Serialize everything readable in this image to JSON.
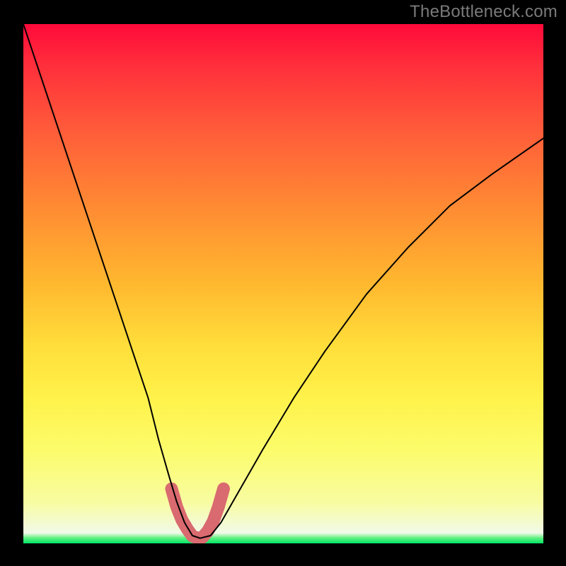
{
  "watermark": "TheBottleneck.com",
  "chart_data": {
    "type": "line",
    "title": "",
    "xlabel": "",
    "ylabel": "",
    "xlim": [
      0,
      100
    ],
    "ylim": [
      0,
      100
    ],
    "grid": false,
    "series": [
      {
        "name": "bottleneck-curve",
        "x": [
          0,
          3,
          6,
          9,
          12,
          15,
          18,
          21,
          24,
          26,
          28,
          29.5,
          31,
          32.5,
          34,
          36,
          38,
          42,
          46,
          52,
          58,
          66,
          74,
          82,
          90,
          100
        ],
        "y": [
          100,
          91,
          82,
          73,
          64,
          55,
          46,
          37,
          28,
          20,
          13,
          8,
          4,
          1.5,
          1,
          1.5,
          4,
          11,
          18,
          28,
          37,
          48,
          57,
          65,
          71,
          78
        ],
        "color": "#000000",
        "stroke_width": 2
      },
      {
        "name": "highlight-u",
        "x": [
          28.5,
          29.5,
          30.5,
          31.5,
          32.5,
          33.5,
          34.5,
          35.5,
          36.5,
          37.5,
          38.5
        ],
        "y": [
          10.5,
          7.0,
          4.5,
          2.8,
          1.4,
          1.0,
          1.2,
          2.4,
          4.2,
          7.0,
          10.5
        ],
        "color": "#d96a6f",
        "stroke_width": 18
      }
    ],
    "background_gradient": {
      "direction": "top-to-bottom",
      "stops": [
        {
          "pos": 0,
          "color": "#ff0a3a"
        },
        {
          "pos": 35,
          "color": "#ff8a33"
        },
        {
          "pos": 62,
          "color": "#ffde3a"
        },
        {
          "pos": 92,
          "color": "#f8fca0"
        },
        {
          "pos": 99,
          "color": "#5cf07e"
        },
        {
          "pos": 100,
          "color": "#00e668"
        }
      ]
    }
  }
}
